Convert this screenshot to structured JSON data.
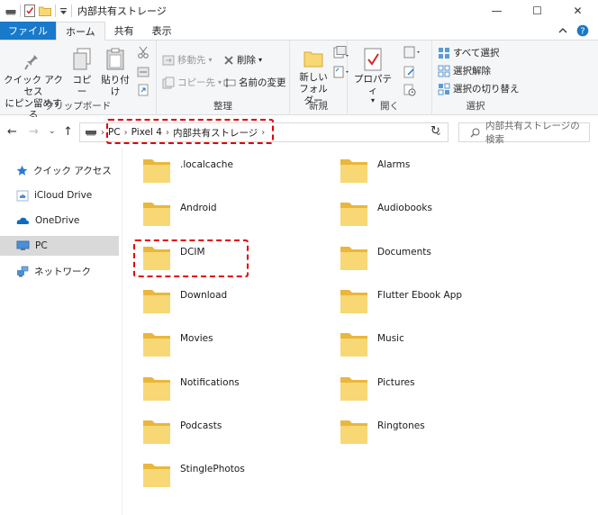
{
  "window": {
    "title": "内部共有ストレージ",
    "controls": {
      "minimize": "—",
      "maximize": "☐",
      "close": "✕"
    }
  },
  "ribbon_tabs": [
    {
      "label": "ファイル"
    },
    {
      "label": "ホーム"
    },
    {
      "label": "共有"
    },
    {
      "label": "表示"
    }
  ],
  "ribbon": {
    "clipboard": {
      "quick_access": [
        "クイック アクセス",
        "にピン留めする"
      ],
      "copy": "コピー",
      "paste": "貼り付け",
      "label": "クリップボード"
    },
    "organize": {
      "move_to": "移動先",
      "copy_to": "コピー先",
      "delete": "削除",
      "rename": "名前の変更",
      "label": "整理"
    },
    "new": {
      "new_folder": [
        "新しい",
        "フォルダー"
      ],
      "label": "新規"
    },
    "open": {
      "properties": "プロパティ",
      "label": "開く"
    },
    "select": {
      "select_all": "すべて選択",
      "select_none": "選択解除",
      "invert": "選択の切り替え",
      "label": "選択"
    }
  },
  "address": {
    "breadcrumbs": [
      "PC",
      "Pixel 4",
      "内部共有ストレージ"
    ],
    "search_placeholder": "内部共有ストレージの検索"
  },
  "nav_pane": [
    {
      "label": "クイック アクセス",
      "icon": "star-icon"
    },
    {
      "label": "iCloud Drive",
      "icon": "icloud-icon"
    },
    {
      "label": "OneDrive",
      "icon": "onedrive-icon"
    },
    {
      "label": "PC",
      "icon": "pc-icon",
      "selected": true
    },
    {
      "label": "ネットワーク",
      "icon": "network-icon"
    }
  ],
  "folders_left": [
    ".localcache",
    "Android",
    "DCIM",
    "Download",
    "Movies",
    "Notifications",
    "Podcasts",
    "StinglePhotos"
  ],
  "folders_right": [
    "Alarms",
    "Audiobooks",
    "Documents",
    "Flutter Ebook App",
    "Music",
    "Pictures",
    "Ringtones"
  ],
  "colors": {
    "file_tab": "#1979ca",
    "folder_yellow": "#f8d775",
    "folder_dark": "#e8b73c",
    "highlight_dash": "#e00000",
    "selected_nav": "#d9d9d9"
  }
}
